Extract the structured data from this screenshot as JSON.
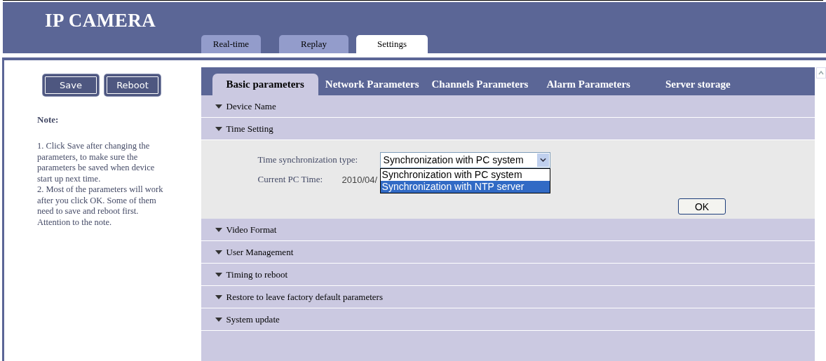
{
  "header": {
    "title": "IP CAMERA"
  },
  "nav_tabs": [
    {
      "label": "Real-time",
      "selected": false
    },
    {
      "label": "Replay",
      "selected": false
    },
    {
      "label": "Settings",
      "selected": true
    }
  ],
  "sidebar": {
    "buttons": [
      "Save",
      "Reboot"
    ],
    "note_title": "Note:",
    "note_lines": [
      "1. Click Save after changing the parameters, to make sure the parameters be saved when device start up next time.",
      "2. Most of the parameters will work after you click OK. Some of them need to save and reboot first. Attention to the note."
    ]
  },
  "settings_tabs": [
    {
      "label": "Basic parameters",
      "selected": true
    },
    {
      "label": "Network Parameters",
      "selected": false
    },
    {
      "label": "Channels Parameters",
      "selected": false
    },
    {
      "label": "Alarm Parameters",
      "selected": false
    },
    {
      "label": "Server storage",
      "selected": false
    }
  ],
  "sections": [
    {
      "label": "Device Name"
    },
    {
      "label": "Time Setting",
      "sync_label": "Time synchronization type:",
      "sync_value": "Synchronization with PC system",
      "sync_options": [
        {
          "label": "Synchronization with PC system",
          "selected": false
        },
        {
          "label": "Synchronization with NTP server",
          "selected": true
        }
      ],
      "time_label": "Current PC Time:",
      "time_value": "2010/04/",
      "ok_button": "OK"
    },
    {
      "label": "Video Format"
    },
    {
      "label": "User Management"
    },
    {
      "label": "Timing to reboot"
    },
    {
      "label": "Restore to leave factory default parameters"
    },
    {
      "label": "System update"
    }
  ]
}
